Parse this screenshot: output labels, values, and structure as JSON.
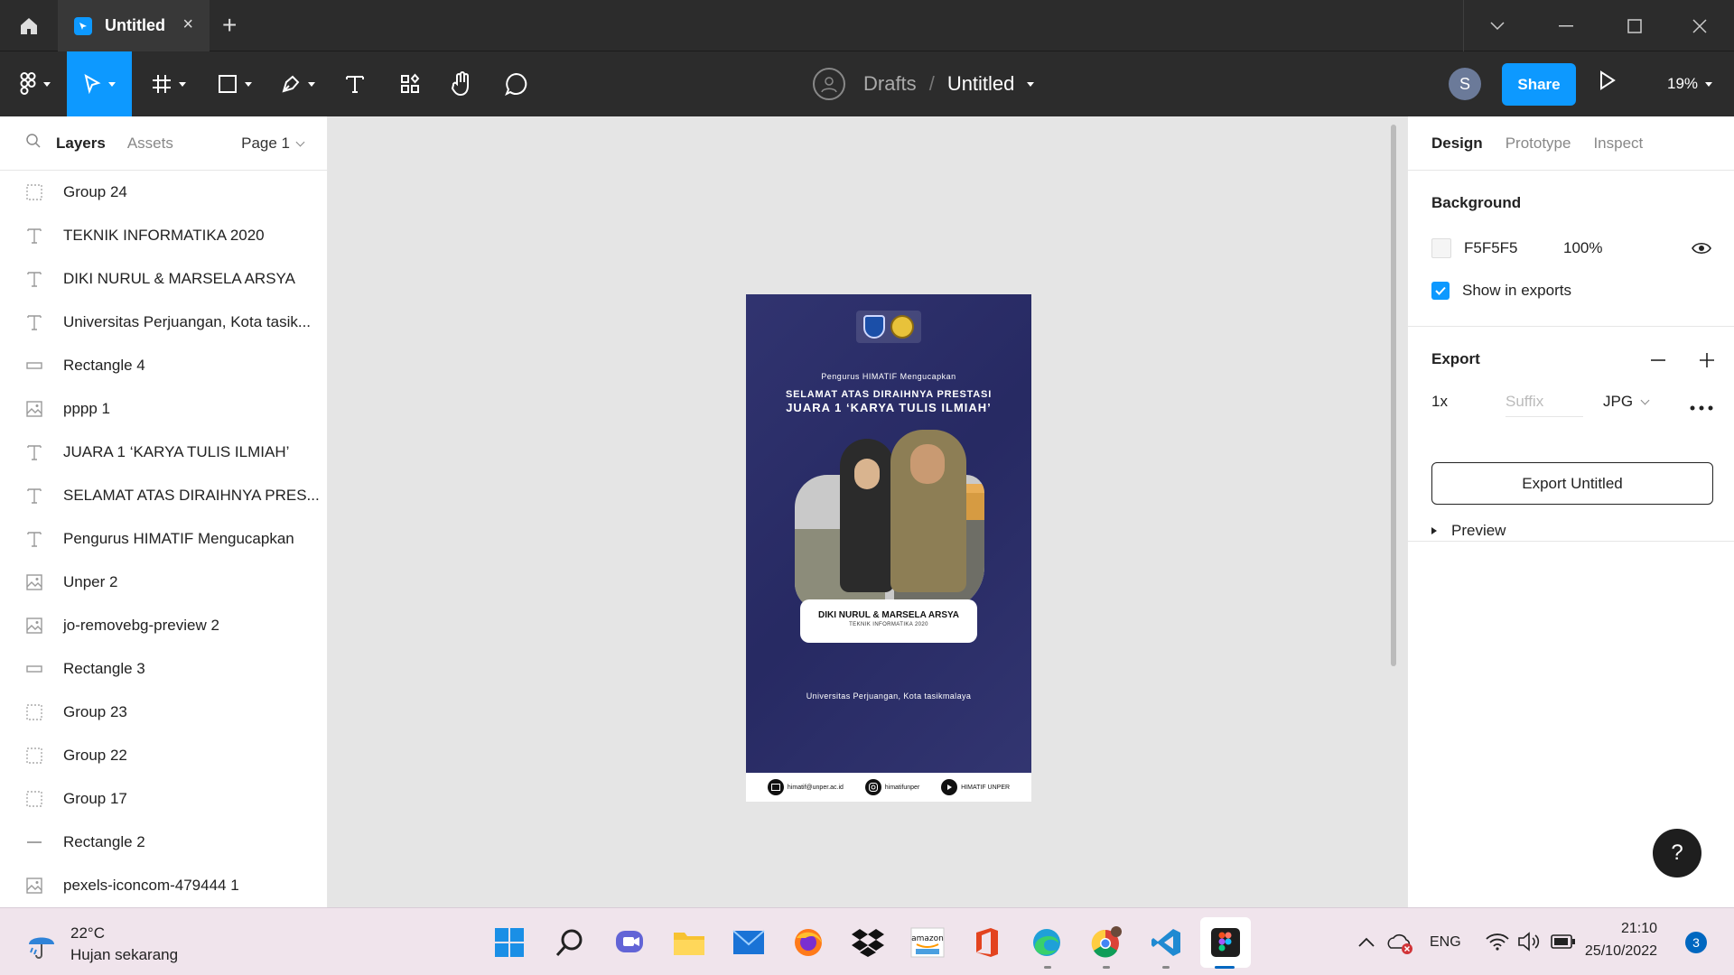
{
  "titlebar": {
    "tab_title": "Untitled",
    "tab_close": "×",
    "new_tab": "+"
  },
  "toolbar": {
    "breadcrumb_drafts": "Drafts",
    "breadcrumb_slash": "/",
    "file_title": "Untitled",
    "user_initial": "S",
    "share_label": "Share",
    "zoom": "19%"
  },
  "left_panel": {
    "tab_layers": "Layers",
    "tab_assets": "Assets",
    "page": "Page 1",
    "layers": [
      {
        "icon": "group-icon",
        "label": "Group 24"
      },
      {
        "icon": "text-icon",
        "label": "TEKNIK INFORMATIKA 2020"
      },
      {
        "icon": "text-icon",
        "label": "DIKI NURUL & MARSELA ARSYA"
      },
      {
        "icon": "text-icon",
        "label": "Universitas Perjuangan, Kota tasik..."
      },
      {
        "icon": "rectangle-icon",
        "label": "Rectangle 4"
      },
      {
        "icon": "image-icon",
        "label": "pppp 1"
      },
      {
        "icon": "text-icon",
        "label": "JUARA 1 ‘KARYA TULIS ILMIAH’"
      },
      {
        "icon": "text-icon",
        "label": "SELAMAT ATAS DIRAIHNYA PRES..."
      },
      {
        "icon": "text-icon",
        "label": "Pengurus HIMATIF Mengucapkan"
      },
      {
        "icon": "image-icon",
        "label": "Unper 2"
      },
      {
        "icon": "image-icon",
        "label": "jo-removebg-preview 2"
      },
      {
        "icon": "rectangle-icon",
        "label": "Rectangle 3"
      },
      {
        "icon": "group-icon",
        "label": "Group 23"
      },
      {
        "icon": "group-icon",
        "label": "Group 22"
      },
      {
        "icon": "group-icon",
        "label": "Group 17"
      },
      {
        "icon": "line-icon",
        "label": "Rectangle 2"
      },
      {
        "icon": "image-icon",
        "label": "pexels-iconcom-479444 1"
      }
    ]
  },
  "poster": {
    "subtitle": "Pengurus HIMATIF Mengucapkan",
    "line1": "SELAMAT ATAS DIRAIHNYA PRESTASI",
    "line2": "JUARA 1 ‘KARYA TULIS ILMIAH’",
    "names": "DIKI NURUL & MARSELA ARSYA",
    "dept": "TEKNIK INFORMATIKA 2020",
    "univ": "Universitas Perjuangan, Kota tasikmalaya",
    "email": "himatif@unper.ac.id",
    "instagram": "himatifunper",
    "youtube": "HIMATIF UNPER",
    "background_color": "#2a2d6b"
  },
  "right_panel": {
    "tab_design": "Design",
    "tab_prototype": "Prototype",
    "tab_inspect": "Inspect",
    "background_title": "Background",
    "bg_hex": "F5F5F5",
    "bg_opacity": "100%",
    "show_in_exports": "Show in exports",
    "show_in_exports_checked": true,
    "export_title": "Export",
    "export_scale": "1x",
    "export_suffix_placeholder": "Suffix",
    "export_format": "JPG",
    "export_button": "Export Untitled",
    "preview_label": "Preview",
    "help": "?"
  },
  "taskbar": {
    "temperature": "22°C",
    "weather": "Hujan sekarang",
    "lang": "ENG",
    "time": "21:10",
    "date": "25/10/2022",
    "notifications": "3",
    "amazon_label": "amazon"
  },
  "colors": {
    "accent": "#0d99ff",
    "chrome": "#2c2c2c",
    "canvas": "#e5e5e5"
  }
}
